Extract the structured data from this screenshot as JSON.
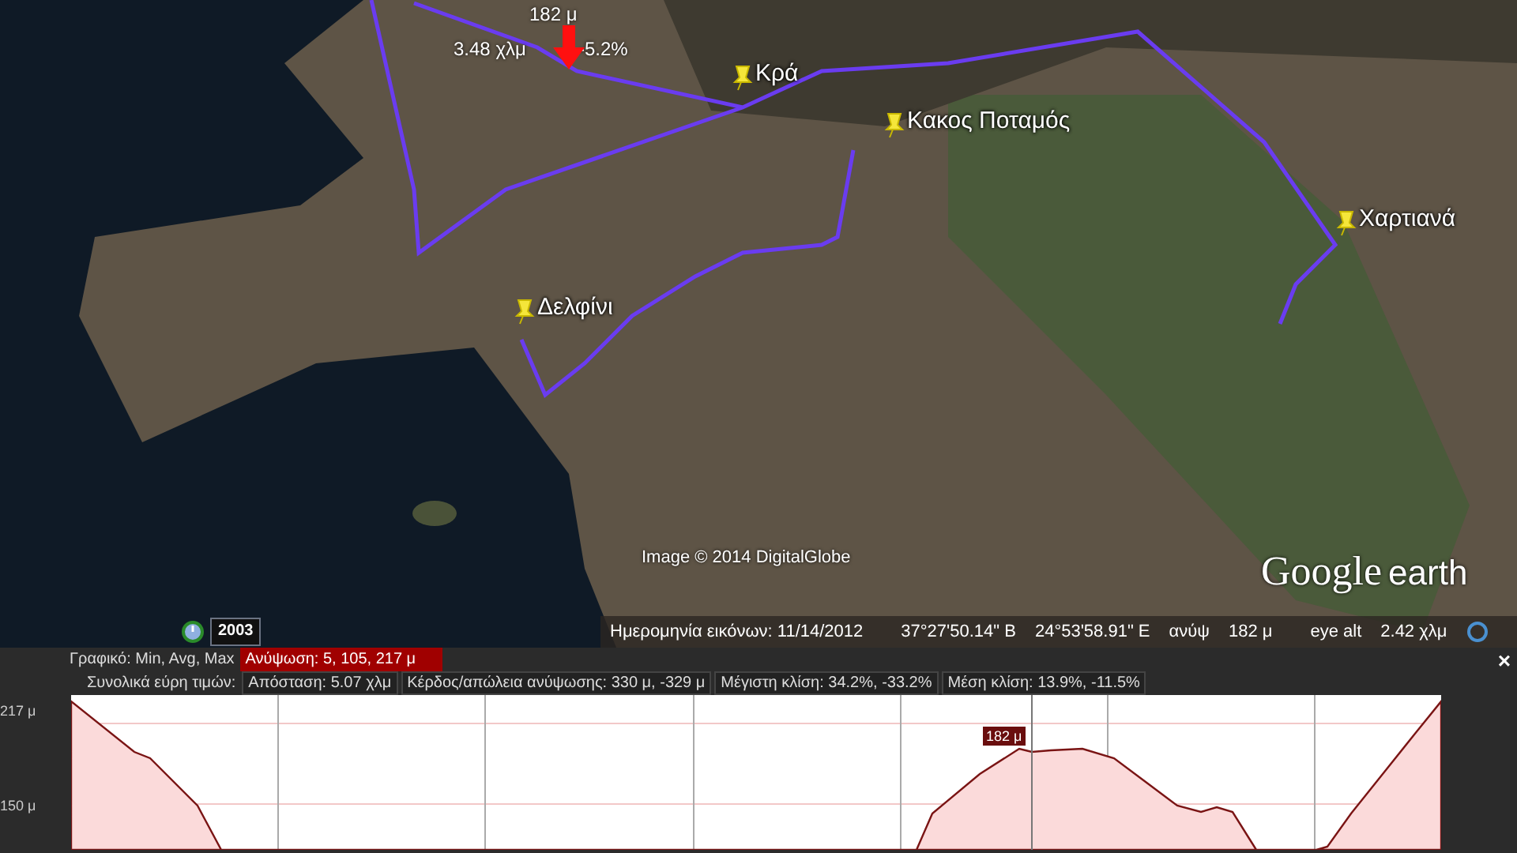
{
  "map": {
    "marker": {
      "elevation": "182 μ",
      "distance": "3.48 χλμ",
      "grade": "-5.2%"
    },
    "placemarks": [
      {
        "label": "Κρά"
      },
      {
        "label": "Κακος Ποταμός"
      },
      {
        "label": "Χαρτιανά"
      },
      {
        "label": "Δελφίνι"
      }
    ],
    "attribution": "Image © 2014 DigitalGlobe",
    "logo": {
      "word1": "Google",
      "word2": "earth"
    },
    "year_badge": "2003",
    "status_bar": {
      "date": "Ημερομηνία εικόνων: 11/14/2012",
      "latitude": "37°27'50.14\" Β",
      "longitude": "24°53'58.91\" Ε",
      "elevation_label": "ανύψ",
      "elevation": "182 μ",
      "eye_label": "eye alt",
      "eye": "2.42 χλμ"
    }
  },
  "profile": {
    "close": "×",
    "graph_label": "Γραφικό: Min, Avg, Max",
    "graph_items": [
      {
        "text": "Ανύψωση: 5, 105, 217 μ",
        "selected": true
      }
    ],
    "totals_label": "Συνολικά εύρη τιμών:",
    "totals": [
      {
        "text": "Απόσταση: 5.07 χλμ"
      },
      {
        "text": "Κέρδος/απώλεια ανύψωσης: 330 μ, -329 μ"
      },
      {
        "text": "Μέγιστη κλίση: 34.2%, -33.2%"
      },
      {
        "text": "Μέση κλίση: 13.9%, -11.5%"
      }
    ],
    "y_labels": [
      "217 μ",
      "150 μ"
    ],
    "cursor_label": "182 μ"
  }
}
